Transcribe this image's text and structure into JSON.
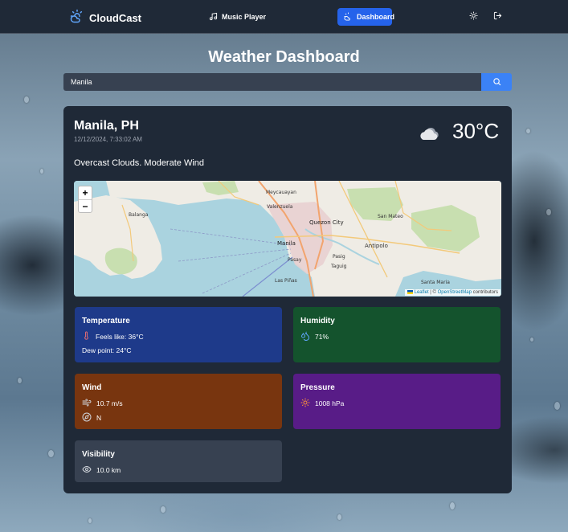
{
  "navbar": {
    "brand": "CloudCast",
    "links": [
      {
        "label": "Music Player",
        "icon": "music-note-icon"
      },
      {
        "label": "Dashboard",
        "icon": "cloud-icon",
        "active": true
      }
    ],
    "theme_icon": "sun-icon",
    "logout_icon": "logout-icon"
  },
  "page": {
    "title": "Weather Dashboard"
  },
  "search": {
    "value": "Manila",
    "button_icon": "search-icon"
  },
  "current": {
    "city": "Manila, PH",
    "datetime": "12/12/2024, 7:33:02 AM",
    "temperature": "30°C",
    "icon": "overcast-cloud-icon",
    "description": "Overcast Clouds. Moderate Wind"
  },
  "map": {
    "zoom_in": "+",
    "zoom_out": "−",
    "attribution_leaflet": "Leaflet",
    "attribution_sep": " | © ",
    "attribution_osm": "OpenStreetMap",
    "attribution_rest": " contributors",
    "places": {
      "meycauayan": "Meycauayan",
      "valenzuela": "Valenzuela",
      "quezon_city": "Quezon City",
      "manila": "Manila",
      "pasig": "Pasig",
      "antipolo": "Antipolo",
      "taguig": "Taguig",
      "pasay": "Pasay",
      "las_pinas": "Las Piñas",
      "balanga": "Balanga",
      "san_mateo": "San Mateo",
      "santa_maria": "Santa Maria"
    }
  },
  "tiles": {
    "temperature": {
      "title": "Temperature",
      "feels_like": "Feels like: 36°C",
      "dew_point": "Dew point: 24°C"
    },
    "humidity": {
      "title": "Humidity",
      "value": "71%"
    },
    "wind": {
      "title": "Wind",
      "speed": "10.7 m/s",
      "direction": "N"
    },
    "pressure": {
      "title": "Pressure",
      "value": "1008 hPa"
    },
    "visibility": {
      "title": "Visibility",
      "value": "10.0 km"
    }
  },
  "colors": {
    "navbar": "#1f2937",
    "accent": "#2563eb",
    "card": "#1f2937",
    "temperature_tile": "#1e3a8a",
    "humidity_tile": "#14532d",
    "wind_tile": "#78350f",
    "pressure_tile": "#581c87",
    "visibility_tile": "#374151"
  }
}
